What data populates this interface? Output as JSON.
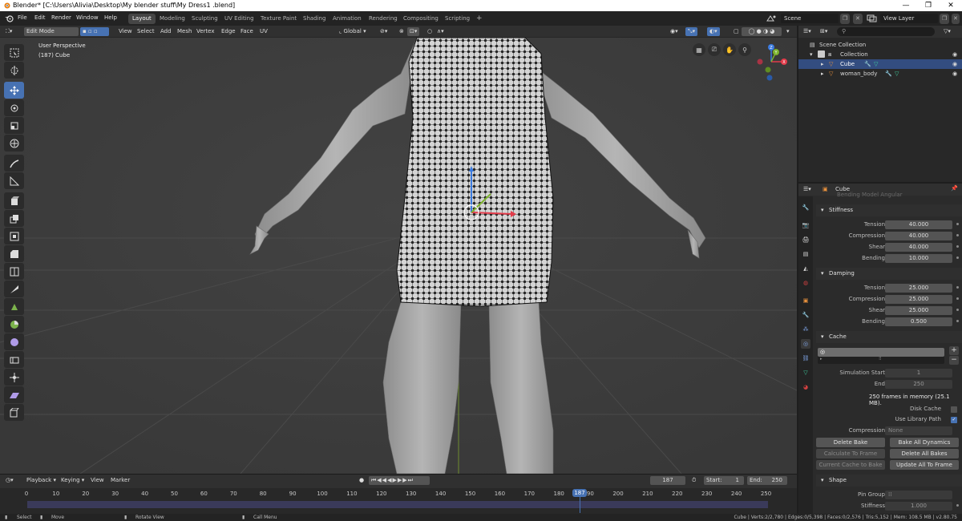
{
  "window": {
    "title": "Blender* [C:\\Users\\Alivia\\Desktop\\My blender stuff\\My Dress1 .blend]",
    "controls": [
      "—",
      "❐",
      "✕"
    ]
  },
  "menu": {
    "items": [
      "File",
      "Edit",
      "Render",
      "Window",
      "Help"
    ]
  },
  "workspaces": [
    "Layout",
    "Modeling",
    "Sculpting",
    "UV Editing",
    "Texture Paint",
    "Shading",
    "Animation",
    "Rendering",
    "Compositing",
    "Scripting",
    "+"
  ],
  "scene": {
    "label": "Scene",
    "view_layer": "View Layer"
  },
  "viewport_header": {
    "mode": "Edit Mode",
    "menus": [
      "View",
      "Select",
      "Add",
      "Mesh",
      "Vertex",
      "Edge",
      "Face",
      "UV"
    ],
    "transform": "Global"
  },
  "viewport": {
    "perspective": "User Perspective",
    "object": "(187) Cube",
    "gizmo_axes": [
      "Z",
      "Y",
      "X"
    ]
  },
  "outliner": {
    "rows": [
      {
        "label": "Scene Collection"
      },
      {
        "label": "Collection"
      },
      {
        "label": "Cube"
      },
      {
        "label": "woman_body"
      }
    ]
  },
  "properties": {
    "object_name": "Cube",
    "faded_header": "Bending Model  Angular",
    "stiffness": {
      "title": "Stiffness",
      "rows": [
        {
          "label": "Tension",
          "value": "40.000"
        },
        {
          "label": "Compression",
          "value": "40.000"
        },
        {
          "label": "Shear",
          "value": "40.000"
        },
        {
          "label": "Bending",
          "value": "10.000"
        }
      ]
    },
    "damping": {
      "title": "Damping",
      "rows": [
        {
          "label": "Tension",
          "value": "25.000"
        },
        {
          "label": "Compression",
          "value": "25.000"
        },
        {
          "label": "Shear",
          "value": "25.000"
        },
        {
          "label": "Bending",
          "value": "0.500"
        }
      ]
    },
    "cache": {
      "title": "Cache",
      "sim_start_label": "Simulation Start",
      "sim_start": "1",
      "end_label": "End",
      "end": "250",
      "memory_info": "250 frames in memory (25.1 MB).",
      "disk_cache": "Disk Cache",
      "use_library_path": "Use Library Path",
      "compression_label": "Compression",
      "compression_value": "None",
      "buttons": [
        "Delete Bake",
        "Bake All Dynamics",
        "Calculate To Frame",
        "Delete All Bakes",
        "Current Cache to Bake",
        "Update All To Frame"
      ]
    },
    "shape": {
      "title": "Shape",
      "pin_group_label": "Pin Group",
      "stiffness_label": "Stiffness",
      "stiffness_value": "1.000"
    }
  },
  "timeline": {
    "menus": [
      "Playback",
      "Keying",
      "View",
      "Marker"
    ],
    "current_frame": "187",
    "start_label": "Start:",
    "start": "1",
    "end_label": "End:",
    "end": "250",
    "ticks": [
      "0",
      "10",
      "20",
      "30",
      "40",
      "50",
      "60",
      "70",
      "80",
      "90",
      "100",
      "110",
      "120",
      "130",
      "140",
      "150",
      "160",
      "170",
      "180",
      "190",
      "200",
      "210",
      "220",
      "230",
      "240",
      "250"
    ]
  },
  "statusbar": {
    "left": [
      "Select",
      "Move",
      "Rotate View",
      "Call Menu"
    ],
    "right": "Cube | Verts:2/2,780 | Edges:0/5,398 | Faces:0/2,576 | Tris:5,152 | Mem: 108.5 MB | v2.80.75"
  }
}
